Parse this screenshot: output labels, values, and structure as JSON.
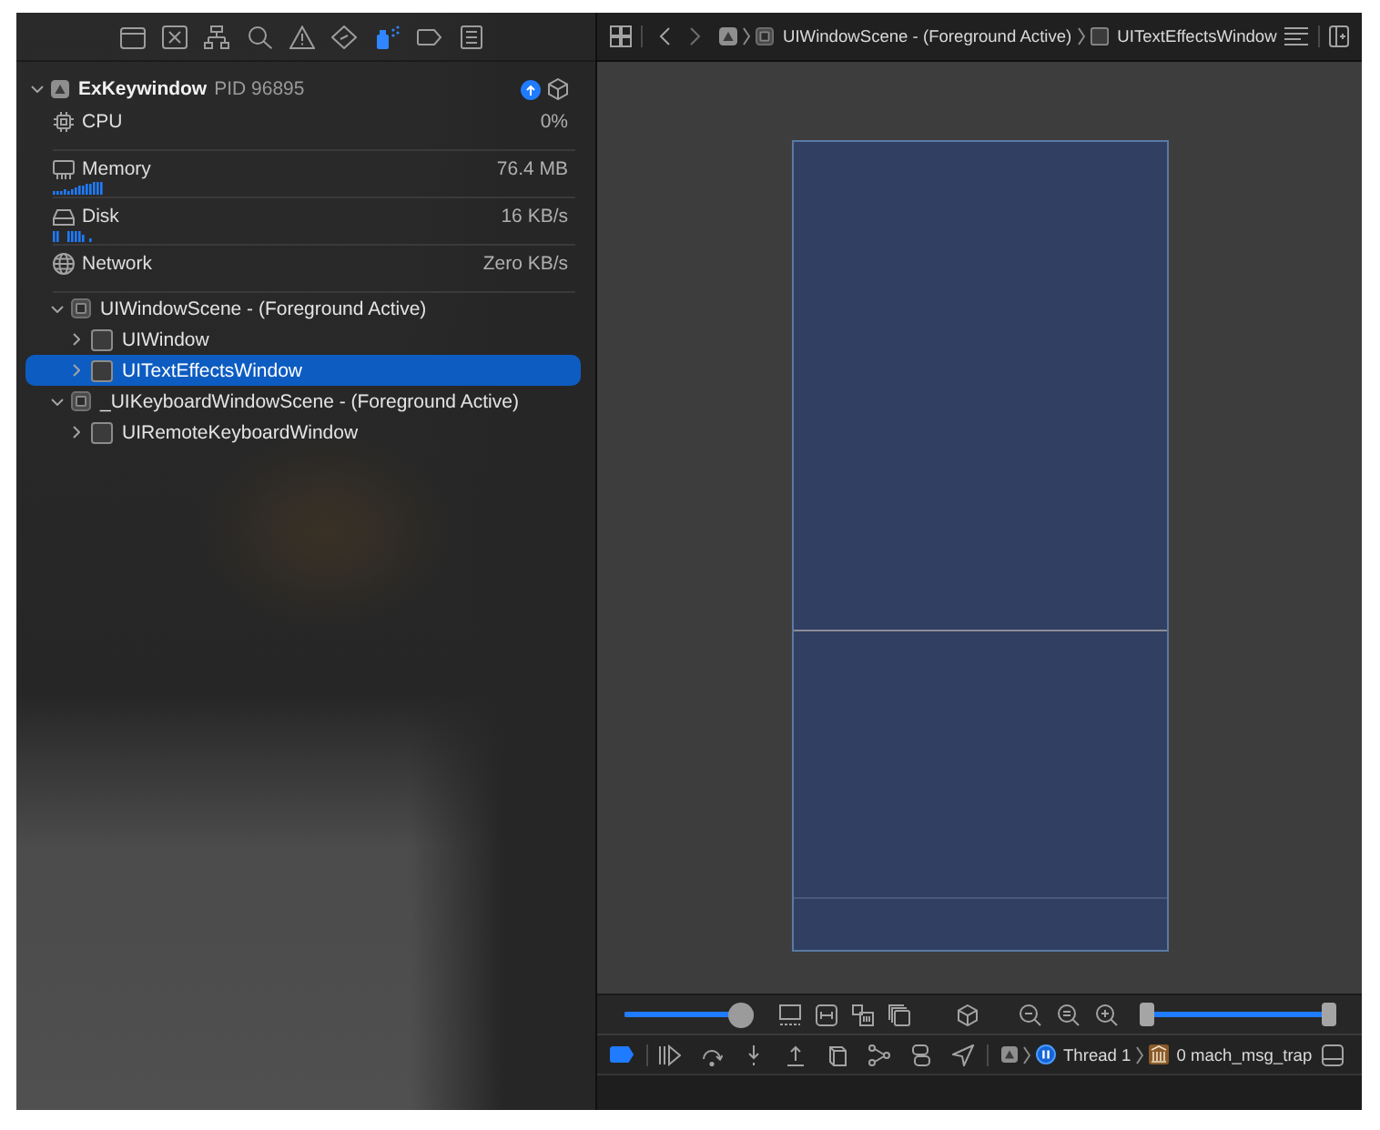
{
  "navigator_tabs": [
    {
      "selected": false
    },
    {
      "selected": false
    },
    {
      "selected": false
    },
    {
      "selected": false
    },
    {
      "selected": false
    },
    {
      "selected": false
    },
    {
      "selected": true
    },
    {
      "selected": false
    },
    {
      "selected": false
    }
  ],
  "process": {
    "name": "ExKeywindow",
    "pid": "PID 96895",
    "expanded": true
  },
  "gauges": [
    {
      "kind": "plain",
      "label": "CPU",
      "value": "0%"
    },
    {
      "kind": "graph",
      "label": "Memory",
      "value": "76.4 MB"
    },
    {
      "kind": "graph",
      "label": "Disk",
      "value": "16 KB/s"
    },
    {
      "kind": "plain",
      "label": "Network",
      "value": "Zero KB/s"
    }
  ],
  "tree": [
    {
      "kind": "scene",
      "label": "UIWindowScene - (Foreground Active)",
      "expanded": true,
      "selected": false,
      "children": [
        {
          "kind": "window",
          "label": "UIWindow",
          "expanded": false,
          "selected": false
        },
        {
          "kind": "window",
          "label": "UITextEffectsWindow",
          "expanded": false,
          "selected": true
        }
      ]
    },
    {
      "kind": "scene",
      "label": "_UIKeyboardWindowScene - (Foreground Active)",
      "expanded": true,
      "selected": false,
      "children": [
        {
          "kind": "window",
          "label": "UIRemoteKeyboardWindow",
          "expanded": false,
          "selected": false
        }
      ]
    }
  ],
  "jump_bar": {
    "crumbs": [
      {
        "kind": "scene",
        "label": "UIWindowScene - (Foreground Active)"
      },
      {
        "kind": "window",
        "label": "UITextEffectsWindow"
      }
    ]
  },
  "canvas_controls": {
    "spacing_slider": {
      "level": 1
    },
    "range_slider": {
      "handles": [
        {
          "level": 0
        },
        {
          "level": 1
        }
      ]
    }
  },
  "debug_bar": {
    "breakpoints_active": true,
    "thread": "Thread 1",
    "frame": "0 mach_msg_trap"
  }
}
